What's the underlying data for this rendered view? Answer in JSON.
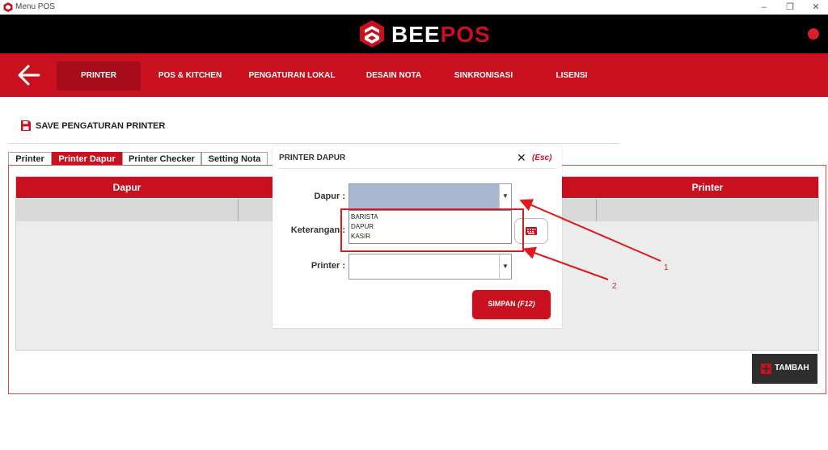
{
  "window": {
    "title": "Menu POS"
  },
  "brand": {
    "part1": "BEE",
    "part2": "POS"
  },
  "nav": {
    "tabs": [
      {
        "label": "PRINTER",
        "active": true
      },
      {
        "label": "POS & KITCHEN"
      },
      {
        "label": "PENGATURAN LOKAL"
      },
      {
        "label": "DESAIN NOTA"
      },
      {
        "label": "SINKRONISASI"
      },
      {
        "label": "LISENSI"
      }
    ]
  },
  "save_label": "SAVE PENGATURAN PRINTER",
  "subtabs": [
    {
      "label": "Printer"
    },
    {
      "label": "Printer Dapur",
      "active": true
    },
    {
      "label": "Printer Checker"
    },
    {
      "label": "Setting Nota"
    }
  ],
  "grid": {
    "columns": [
      "Dapur",
      "Printer"
    ]
  },
  "tambah_label": "TAMBAH",
  "dialog": {
    "title": "PRINTER DAPUR",
    "close_label": "(Esc)",
    "fields": {
      "dapur_label": "Dapur :",
      "keterangan_label": "Keterangan :",
      "printer_label": "Printer :"
    },
    "dapur_options": [
      "BARISTA",
      "DAPUR",
      "KASIR"
    ],
    "save_label": "SIMPAN",
    "save_shortcut": "(F12)"
  },
  "annotations": [
    "1",
    "2"
  ],
  "colors": {
    "accent": "#c8101e",
    "header": "#000000",
    "nav_active": "#a50b18",
    "annotation": "#e0191e"
  }
}
